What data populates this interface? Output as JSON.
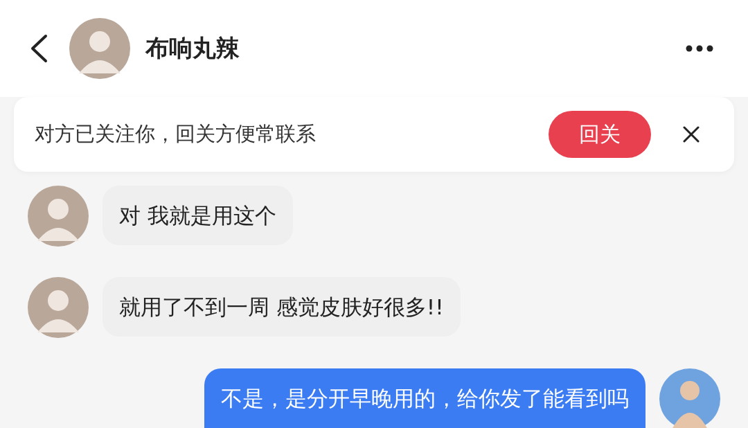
{
  "header": {
    "title": "布响丸辣"
  },
  "follow_banner": {
    "text": "对方已关注你，回关方便常联系",
    "button": "回关"
  },
  "messages": [
    {
      "kind": "received",
      "text": "对  我就是用这个"
    },
    {
      "kind": "received",
      "text": "就用了不到一周  感觉皮肤好很多!!"
    },
    {
      "kind": "sent",
      "text": "不是，是分开早晚用的，给你发了能看到吗"
    }
  ]
}
